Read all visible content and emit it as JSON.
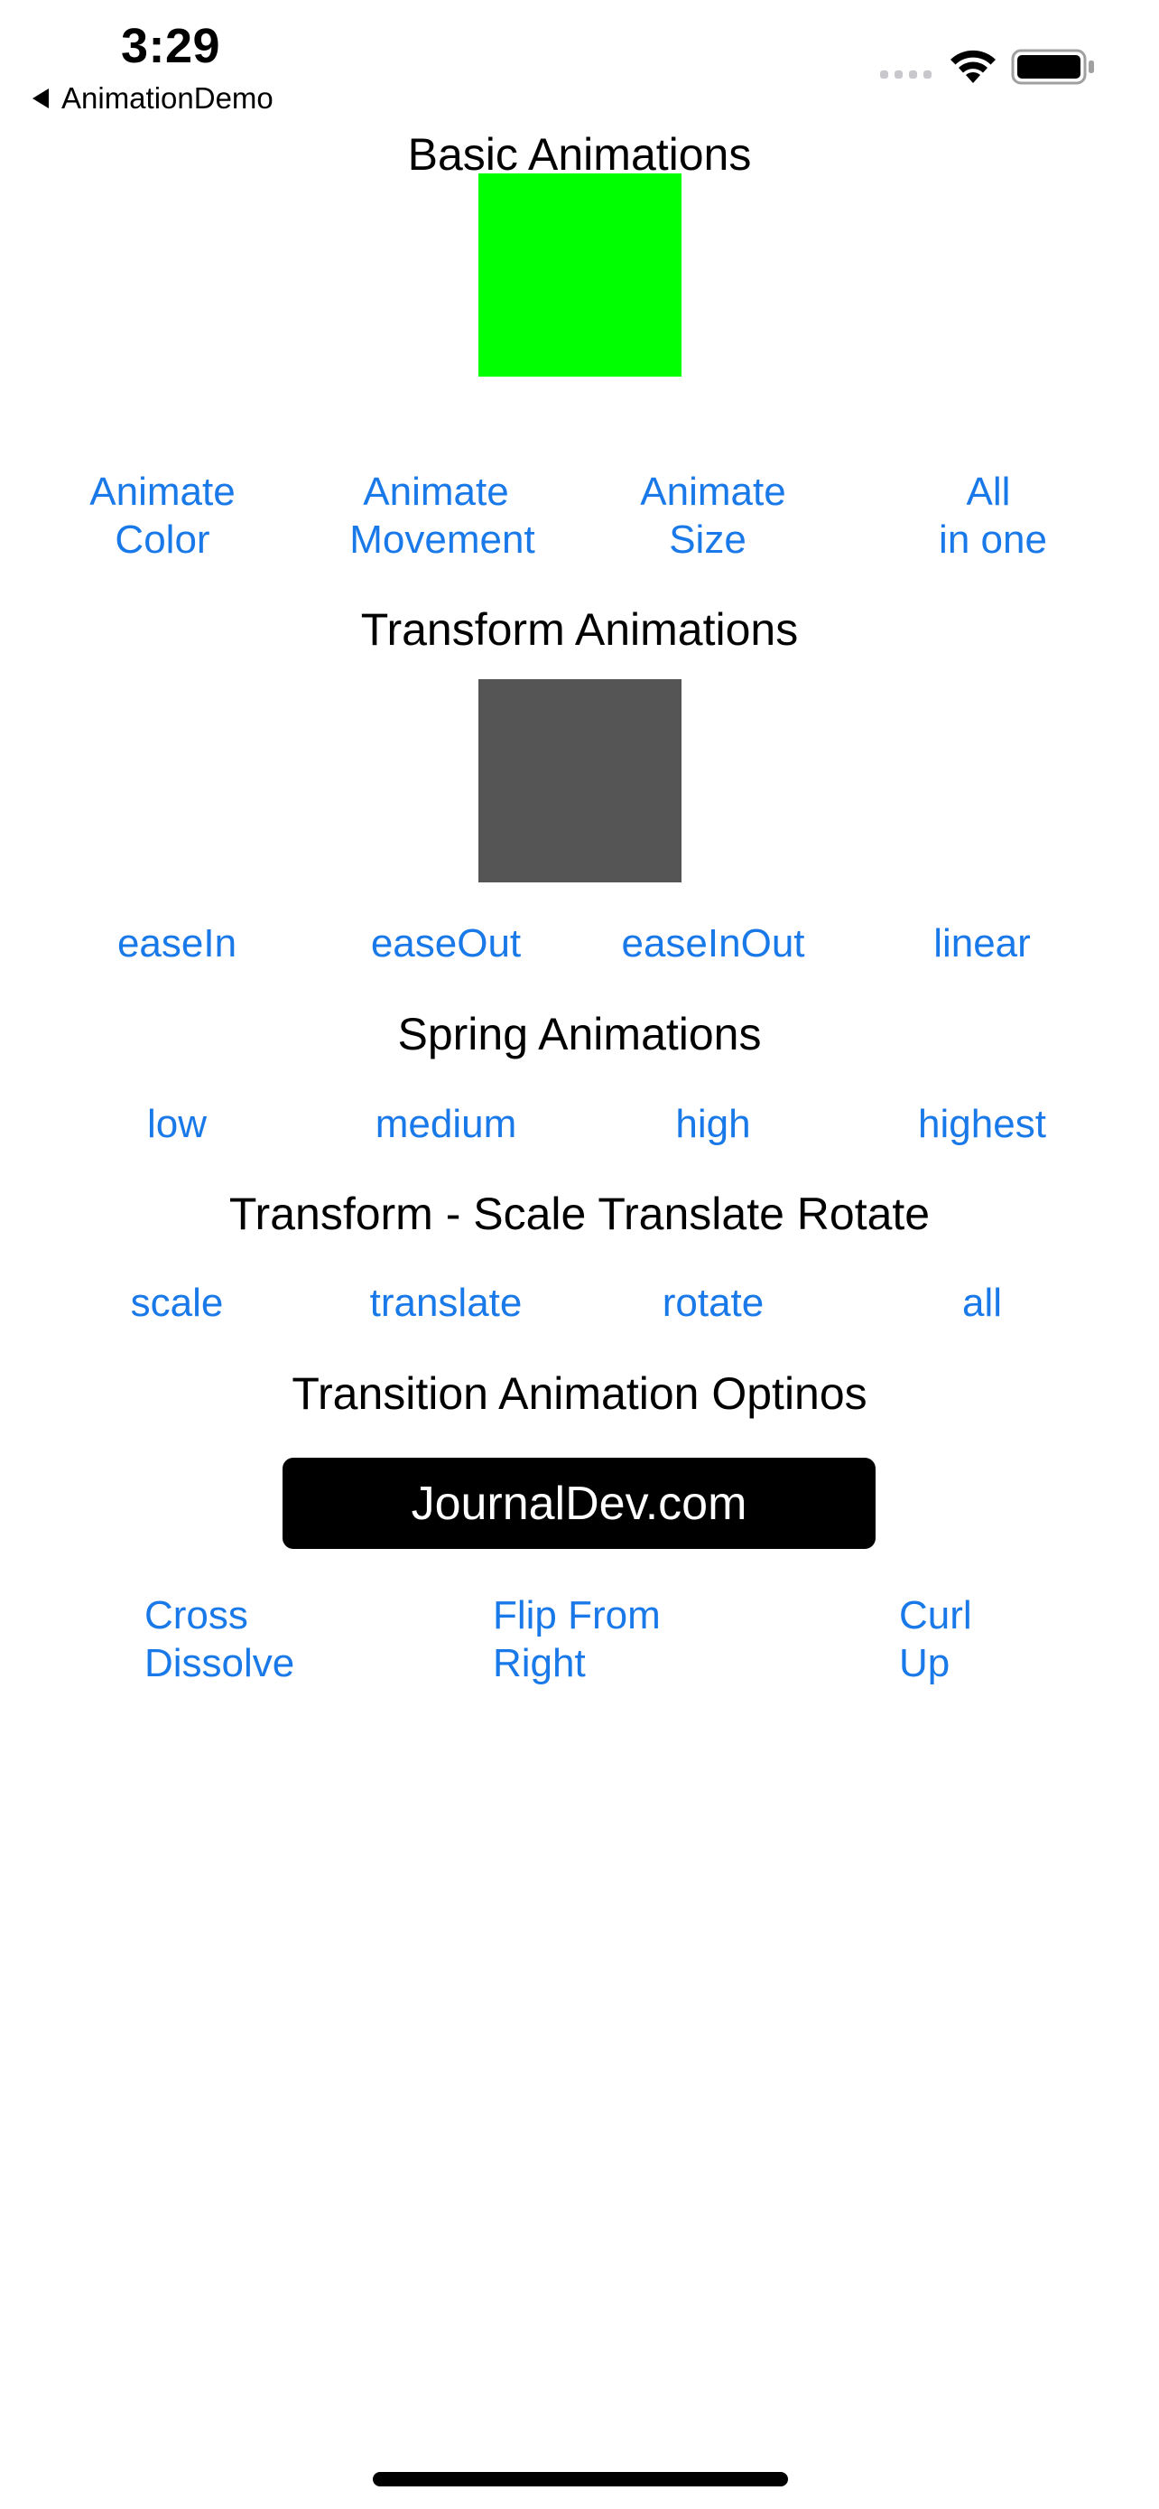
{
  "status": {
    "time": "3:29"
  },
  "nav": {
    "back_label": "AnimationDemo"
  },
  "colors": {
    "accent": "#1a79e8",
    "basic_box": "#00ff00",
    "transform_box": "#555555"
  },
  "basic": {
    "title": "Basic Animations",
    "buttons": [
      {
        "line1": "Animate",
        "line2": "Color"
      },
      {
        "line1": "Animate",
        "line2": "Movement"
      },
      {
        "line1": "Animate",
        "line2": "Size"
      },
      {
        "line1": "All",
        "line2": "in one"
      }
    ]
  },
  "transform": {
    "title": "Transform Animations",
    "buttons": [
      "easeIn",
      "easeOut",
      "easeInOut",
      "linear"
    ]
  },
  "spring": {
    "title": "Spring Animations",
    "buttons": [
      "low",
      "medium",
      "high",
      "highest"
    ]
  },
  "str": {
    "title": "Transform - Scale Translate Rotate",
    "buttons": [
      "scale",
      "translate",
      "rotate",
      "all"
    ]
  },
  "transition": {
    "title": "Transition Animation Optinos",
    "label_button": "JournalDev.com",
    "buttons": [
      {
        "line1": "Cross",
        "line2": "Dissolve"
      },
      {
        "line1": "Flip From",
        "line2": "Right"
      },
      {
        "line1": "Curl",
        "line2": "Up"
      }
    ]
  }
}
